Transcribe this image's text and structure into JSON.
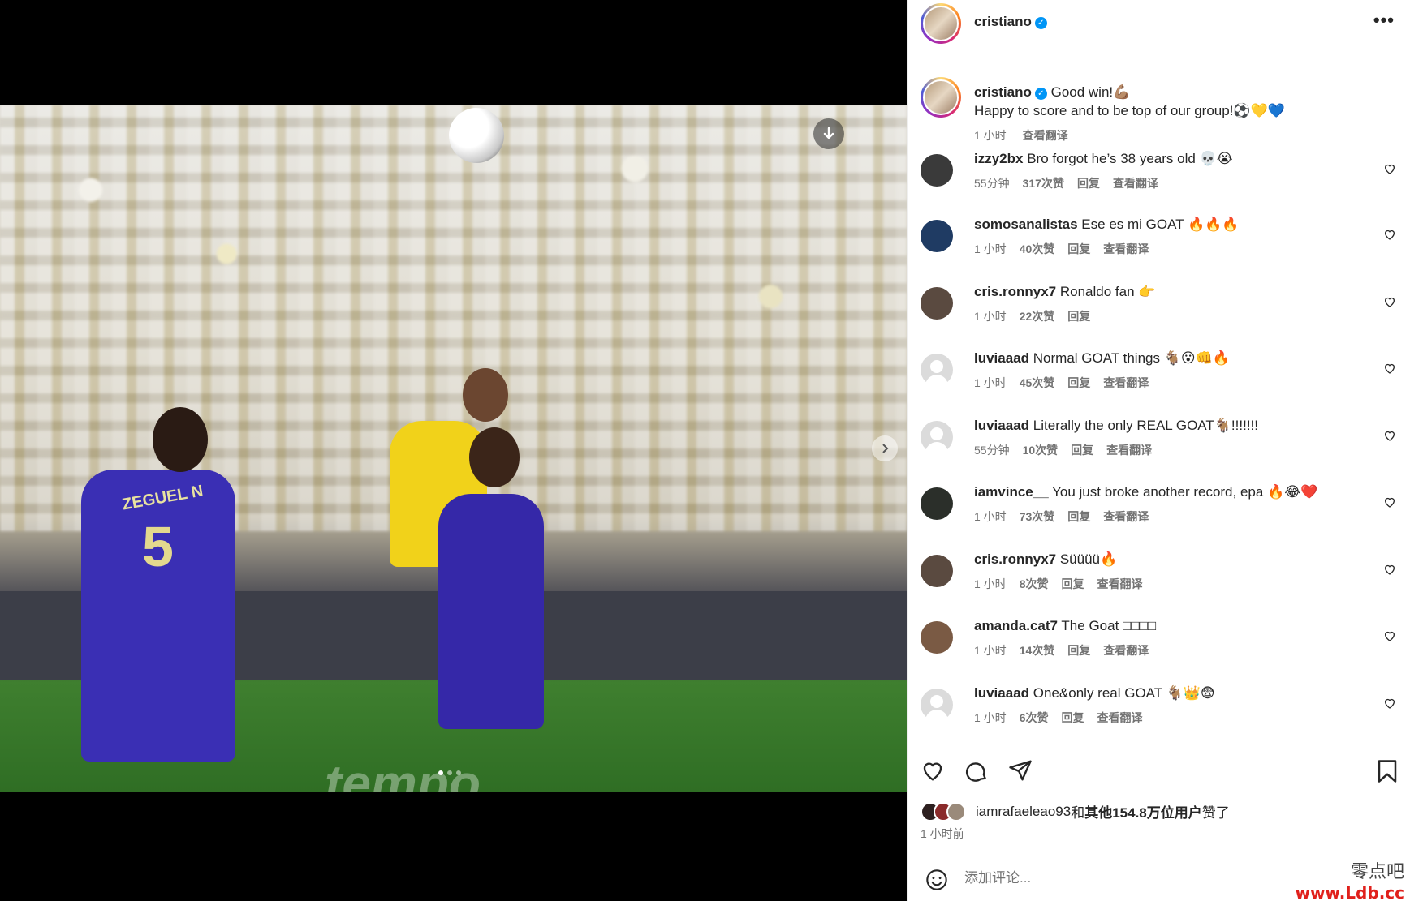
{
  "post": {
    "username": "cristiano",
    "verified": "✓",
    "more": "•••"
  },
  "caption": {
    "username": "cristiano",
    "text_line1": "Good win!💪🏽",
    "text_line2": "Happy to score and to be top of our group!⚽️💛💙",
    "time": "1 小时",
    "translate": "查看翻译"
  },
  "comments": [
    {
      "user": "izzy2bx",
      "text": "Bro forgot he’s 38 years old 💀😭",
      "time": "55分钟",
      "likes": "317次赞",
      "reply": "回复",
      "translate": "查看翻译",
      "avatar_color": "#3a3a3a"
    },
    {
      "user": "somosanalistas",
      "text": "Ese es mi GOAT 🔥🔥🔥",
      "time": "1 小时",
      "likes": "40次赞",
      "reply": "回复",
      "translate": "查看翻译",
      "avatar_color": "#1f3b63"
    },
    {
      "user": "cris.ronnyx7",
      "text": "Ronaldo fan 👉",
      "time": "1 小时",
      "likes": "22次赞",
      "reply": "回复",
      "translate": "",
      "avatar_color": "#5a4a40"
    },
    {
      "user": "luviaaad",
      "text": "Normal GOAT things 🐐😮👊🔥",
      "time": "1 小时",
      "likes": "45次赞",
      "reply": "回复",
      "translate": "查看翻译",
      "avatar_color": "gray"
    },
    {
      "user": "luviaaad",
      "text": "Literally the only REAL GOAT🐐!!!!!!!",
      "time": "55分钟",
      "likes": "10次赞",
      "reply": "回复",
      "translate": "查看翻译",
      "avatar_color": "gray"
    },
    {
      "user": "iamvince__",
      "text": "You just broke another record, epa 🔥😂❤️",
      "time": "1 小时",
      "likes": "73次赞",
      "reply": "回复",
      "translate": "查看翻译",
      "avatar_color": "#2b2f2a"
    },
    {
      "user": "cris.ronnyx7",
      "text": "Süüüü🔥",
      "time": "1 小时",
      "likes": "8次赞",
      "reply": "回复",
      "translate": "查看翻译",
      "avatar_color": "#5a4a40"
    },
    {
      "user": "amanda.cat7",
      "text": "The Goat □□□□",
      "time": "1 小时",
      "likes": "14次赞",
      "reply": "回复",
      "translate": "查看翻译",
      "avatar_color": "#7a5a44"
    },
    {
      "user": "luviaaad",
      "text": "One&only real GOAT 🐐👑😨",
      "time": "1 小时",
      "likes": "6次赞",
      "reply": "回复",
      "translate": "查看翻译",
      "avatar_color": "gray"
    }
  ],
  "likes": {
    "user": "iamrafaeleao93",
    "and": "和",
    "others": "其他154.8万位用户",
    "suffix": "赞了"
  },
  "post_time": "1 小时前",
  "comment_input": {
    "placeholder": "添加评论..."
  },
  "media": {
    "jersey_name": "ZEGUEL N",
    "jersey_number": "5",
    "board_text": "tempo"
  },
  "watermark": {
    "cn": "零点吧",
    "url": "www.Ldb.cc"
  },
  "colors": {
    "accent": "#0095f6",
    "secondary_text": "#737373",
    "watermark_red": "#e0201b"
  }
}
